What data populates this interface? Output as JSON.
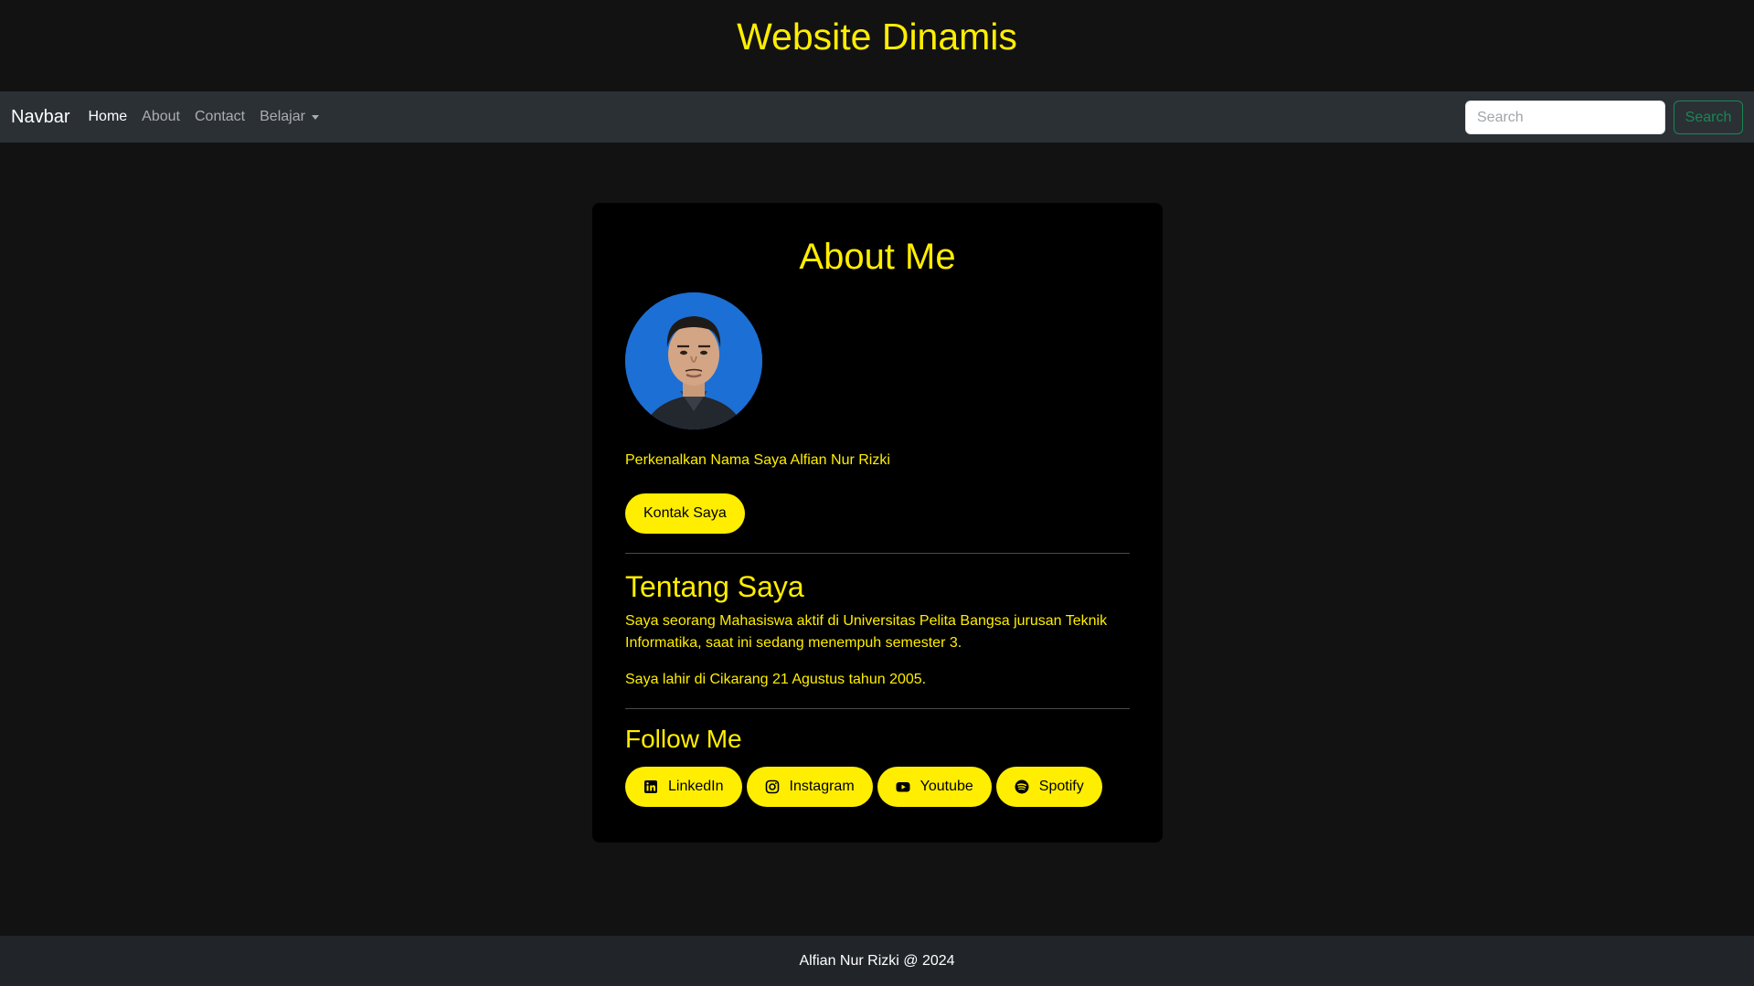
{
  "header": {
    "title": "Website Dinamis"
  },
  "navbar": {
    "brand": "Navbar",
    "links": [
      {
        "label": "Home",
        "active": true
      },
      {
        "label": "About",
        "active": false
      },
      {
        "label": "Contact",
        "active": false
      },
      {
        "label": "Belajar",
        "active": false,
        "dropdown": true
      }
    ],
    "search": {
      "placeholder": "Search",
      "button_label": "Search"
    }
  },
  "card": {
    "title": "About Me",
    "avatar_icon": "profile-photo",
    "intro": "Perkenalkan Nama Saya Alfian Nur Rizki",
    "contact_button": "Kontak Saya",
    "about": {
      "title": "Tentang Saya",
      "paragraphs": [
        "Saya seorang Mahasiswa aktif di Universitas Pelita Bangsa jurusan Teknik Informatika, saat ini sedang menempuh semester 3.",
        "Saya lahir di Cikarang 21 Agustus tahun 2005."
      ]
    },
    "follow": {
      "title": "Follow Me",
      "buttons": [
        {
          "label": "LinkedIn",
          "icon": "linkedin-icon"
        },
        {
          "label": "Instagram",
          "icon": "instagram-icon"
        },
        {
          "label": "Youtube",
          "icon": "youtube-icon"
        },
        {
          "label": "Spotify",
          "icon": "spotify-icon"
        }
      ]
    }
  },
  "footer": {
    "text": "Alfian Nur Rizki @ 2024"
  },
  "colors": {
    "accent": "#ffee00",
    "background": "#121212",
    "navbar": "#2b3035",
    "card": "#000000",
    "footer": "#212529",
    "search_button": "#198754"
  }
}
